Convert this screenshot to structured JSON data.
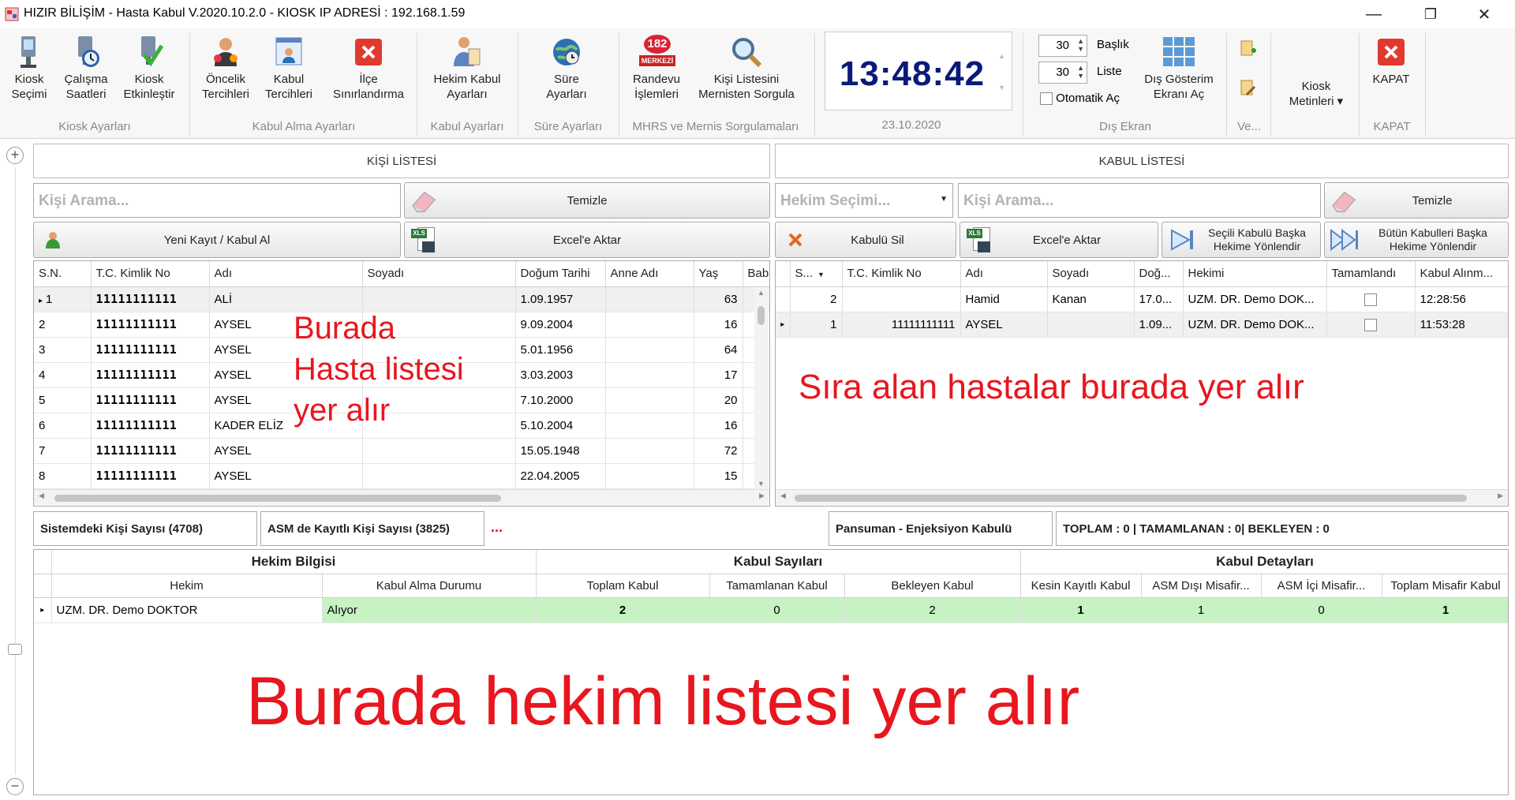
{
  "window": {
    "title": "HIZIR BİLİŞİM - Hasta Kabul V.2020.10.2.0  -  KIOSK IP ADRESİ : 192.168.1.59",
    "minimize": "—",
    "restore": "❐",
    "close": "✕"
  },
  "ribbon": {
    "groups": [
      {
        "label": "Kiosk Ayarları"
      },
      {
        "label": "Kabul Alma Ayarları"
      },
      {
        "label": "Kabul Ayarları"
      },
      {
        "label": "Süre Ayarları"
      },
      {
        "label": "MHRS ve Mernis Sorgulamaları"
      },
      {
        "label": "23.10.2020"
      },
      {
        "label": "Dış Ekran"
      },
      {
        "label": "Ve..."
      },
      {
        "label": "KAPAT"
      }
    ],
    "buttons": {
      "kiosk_secimi": "Kiosk\nSeçimi",
      "calisma_saatleri": "Çalışma\nSaatleri",
      "kiosk_etkinlestir": "Kiosk\nEtkinleştir",
      "oncelik_tercihleri": "Öncelik\nTercihleri",
      "kabul_tercihleri": "Kabul\nTercihleri",
      "ilce_sinirlandirma": "İlçe\nSınırlandırma",
      "hekim_kabul_ayarlari": "Hekim Kabul\nAyarları",
      "sure_ayarlari": "Süre\nAyarları",
      "randevu_islemleri": "Randevu\nİşlemleri",
      "kisi_listesini_sorgula": "Kişi Listesini\nMernisten Sorgula",
      "dis_gosterim": "Dış Gösterim\nEkranı Aç",
      "kiosk_metinleri": "Kiosk\nMetinleri ▾",
      "kapat": "KAPAT"
    },
    "badge_182": "182",
    "badge_merkezi": "MERKEZİ",
    "clock": "13:48:42",
    "date": "23.10.2020",
    "baslik_value": "30",
    "baslik_label": "Başlık",
    "liste_value": "30",
    "liste_label": "Liste",
    "otomatik_label": "Otomatik Aç"
  },
  "left_panel": {
    "header": "KİŞİ LİSTESİ",
    "search_placeholder": "Kişi Arama...",
    "clear_button": "Temizle",
    "new_record_button": "Yeni Kayıt / Kabul Al",
    "excel_button": "Excel'e Aktar",
    "xls": "XLS",
    "columns": [
      "S.N.",
      "T.C. Kimlik No",
      "Adı",
      "Soyadı",
      "Doğum Tarihi",
      "Anne Adı",
      "Yaş",
      "Baba"
    ],
    "rows": [
      {
        "sn": "1",
        "tc": "11111111111",
        "adi": "ALİ",
        "soyadi": "",
        "dogum": "1.09.1957",
        "anne": "",
        "yas": "63"
      },
      {
        "sn": "2",
        "tc": "11111111111",
        "adi": "AYSEL",
        "soyadi": "",
        "dogum": "9.09.2004",
        "anne": "",
        "yas": "16"
      },
      {
        "sn": "3",
        "tc": "11111111111",
        "adi": "AYSEL",
        "soyadi": "",
        "dogum": "5.01.1956",
        "anne": "",
        "yas": "64"
      },
      {
        "sn": "4",
        "tc": "11111111111",
        "adi": "AYSEL",
        "soyadi": "",
        "dogum": "3.03.2003",
        "anne": "",
        "yas": "17"
      },
      {
        "sn": "5",
        "tc": "11111111111",
        "adi": "AYSEL",
        "soyadi": "",
        "dogum": "7.10.2000",
        "anne": "",
        "yas": "20"
      },
      {
        "sn": "6",
        "tc": "11111111111",
        "adi": "KADER ELİZ",
        "soyadi": "",
        "dogum": "5.10.2004",
        "anne": "",
        "yas": "16"
      },
      {
        "sn": "7",
        "tc": "11111111111",
        "adi": "AYSEL",
        "soyadi": "",
        "dogum": "15.05.1948",
        "anne": "",
        "yas": "72"
      },
      {
        "sn": "8",
        "tc": "11111111111",
        "adi": "AYSEL",
        "soyadi": "",
        "dogum": "22.04.2005",
        "anne": "",
        "yas": "15"
      }
    ],
    "annotation_1": "Burada",
    "annotation_2": "Hasta listesi",
    "annotation_3": "yer alır",
    "count_label": "Sistemdeki Kişi Sayısı (4708)",
    "asm_label": "ASM de Kayıtlı Kişi Sayısı (3825)",
    "dots": "..."
  },
  "right_panel": {
    "header": "KABUL LİSTESİ",
    "hekim_placeholder": "Hekim Seçimi...",
    "search_placeholder": "Kişi Arama...",
    "clear_button": "Temizle",
    "delete_button": "Kabulü Sil",
    "excel_button": "Excel'e Aktar",
    "redirect_one": "Seçili Kabulü Başka\nHekime Yönlendir",
    "redirect_all": "Bütün Kabulleri Başka\nHekime Yönlendir",
    "columns": [
      "S...",
      "T.C. Kimlik No",
      "Adı",
      "Soyadı",
      "Doğ...",
      "Hekimi",
      "Tamamlandı",
      "Kabul Alınm..."
    ],
    "rows": [
      {
        "sira": "2",
        "tc": "",
        "adi": "Hamid",
        "soyadi": "Kanan",
        "dogum": "17.0...",
        "hekim": "UZM. DR. Demo DOK...",
        "saat": "12:28:56"
      },
      {
        "sira": "1",
        "tc": "11111111111",
        "adi": "AYSEL",
        "soyadi": "",
        "dogum": "1.09...",
        "hekim": "UZM. DR. Demo DOK...",
        "saat": "11:53:28"
      }
    ],
    "annotation": "Sıra alan hastalar burada yer alır",
    "pansuman_label": "Pansuman - Enjeksiyon Kabulü",
    "totals_label": "TOPLAM : 0 | TAMAMLANAN : 0| BEKLEYEN : 0"
  },
  "hekim_grid": {
    "groups": [
      "Hekim Bilgisi",
      "Kabul Sayıları",
      "Kabul Detayları"
    ],
    "columns": [
      "Hekim",
      "Kabul Alma Durumu",
      "Toplam Kabul",
      "Tamamlanan Kabul",
      "Bekleyen Kabul",
      "Kesin Kayıtlı Kabul",
      "ASM Dışı Misafir...",
      "ASM İçi Misafir...",
      "Toplam Misafir Kabul"
    ],
    "rows": [
      {
        "hekim": "UZM. DR. Demo DOKTOR",
        "durum": "Alıyor",
        "toplam": "2",
        "tamamlanan": "0",
        "bekleyen": "2",
        "kesin": "1",
        "asm_disi": "1",
        "asm_ici": "0",
        "toplam_misafir": "1"
      }
    ],
    "annotation": "Burada hekim listesi yer alır"
  },
  "side": {
    "expand": "+",
    "collapse": "−"
  },
  "colors": {
    "annotation": "#e8161e",
    "clock": "#0a1a7a",
    "active_row": "#c7f2c4"
  }
}
